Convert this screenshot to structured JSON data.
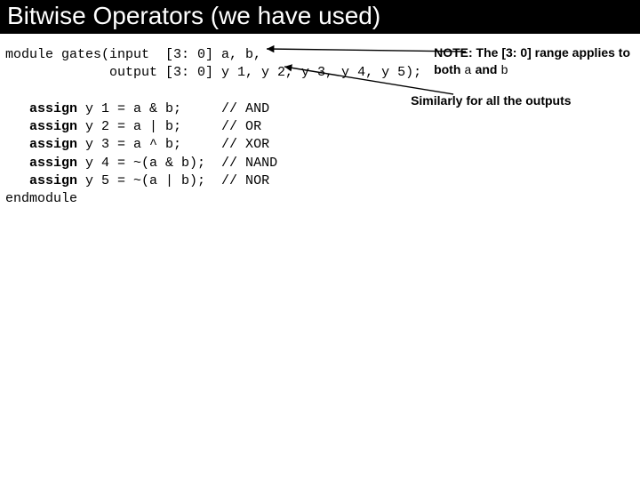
{
  "title": "Bitwise Operators (we have used)",
  "code": {
    "line1a": "module gates(input  [3: 0] a, b,",
    "line1b": "             output [3: 0] y 1, y 2, y 3, y 4, y 5);",
    "blank": "",
    "kw_assign": "assign",
    "l3b": " y 1 = a & b;     // AND",
    "l4b": " y 2 = a | b;     // OR",
    "l5b": " y 3 = a ^ b;     // XOR",
    "l6b": " y 4 = ~(a & b);  // NAND",
    "l7b": " y 5 = ~(a | b);  // NOR",
    "line8": "endmodule"
  },
  "notes": {
    "n1_a": "NOTE:  The ",
    "n1_range": "[3: 0]",
    "n1_b": " range applies to both ",
    "n1_a_var": "a",
    "n1_c": " and ",
    "n1_b_var": "b",
    "n2": "Similarly for all the outputs"
  }
}
